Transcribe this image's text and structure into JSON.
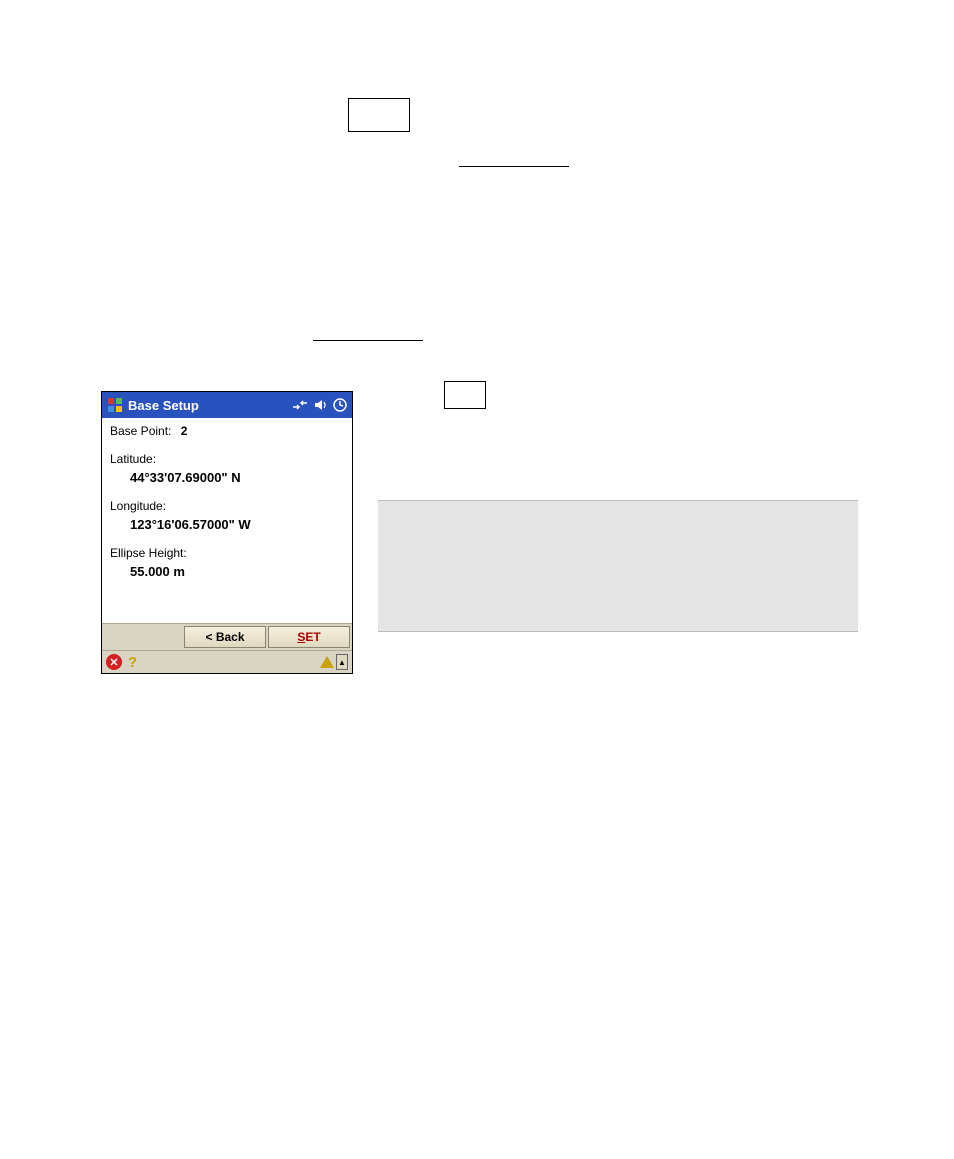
{
  "device": {
    "title": "Base Setup",
    "basepoint": {
      "label": "Base Point:",
      "value": "2"
    },
    "latitude": {
      "label": "Latitude:",
      "value": "44°33'07.69000\" N"
    },
    "longitude": {
      "label": "Longitude:",
      "value": "123°16'06.57000\" W"
    },
    "ellipse_height": {
      "label": "Ellipse Height:",
      "value": "55.000 m"
    },
    "buttons": {
      "back": "< Back",
      "set_prefix": "S",
      "set_suffix": "ET"
    }
  }
}
